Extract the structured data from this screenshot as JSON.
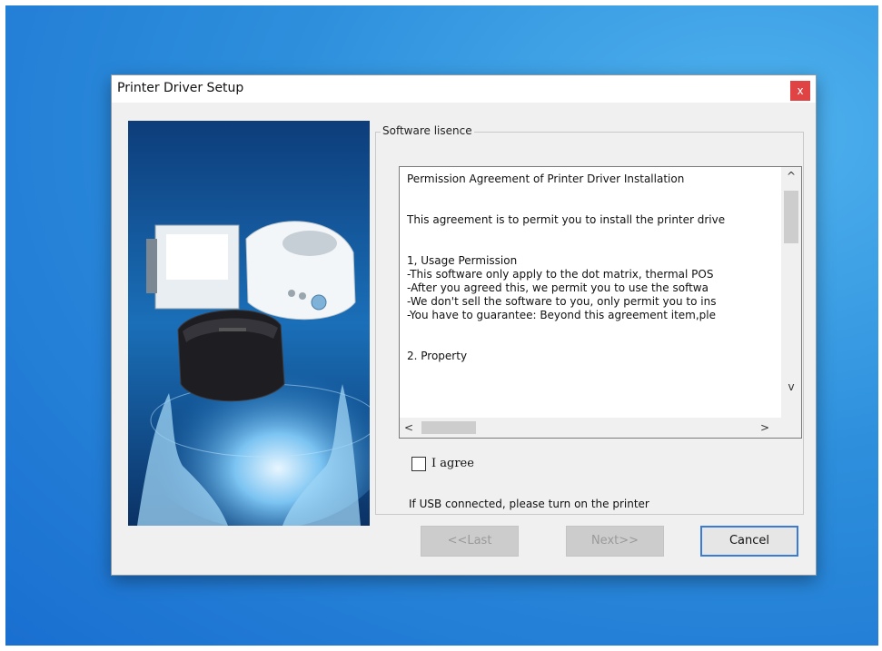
{
  "window": {
    "title": "Printer Driver Setup",
    "close_label": "x"
  },
  "license_group": {
    "label": "Software lisence",
    "text": "Permission Agreement of Printer Driver Installation\n\n\nThis agreement is to permit you to install the printer drive\n\n\n1, Usage Permission\n-This software only apply to the dot matrix, thermal POS\n-After you agreed this, we permit you to use the softwa\n-We don't sell the software to you, only permit you to ins\n-You have to guarantee: Beyond this agreement item,ple\n\n\n2. Property",
    "scroll_up_icon": "chevron-up",
    "scroll_down_icon": "chevron-down",
    "scroll_left_icon": "chevron-left",
    "scroll_right_icon": "chevron-right",
    "scroll_up_glyph": "^",
    "scroll_down_glyph": "v",
    "scroll_left_glyph": "<",
    "scroll_right_glyph": ">"
  },
  "agree": {
    "label": "I agree",
    "checked": false
  },
  "usb_note": "If USB connected, please turn on the printer",
  "buttons": {
    "last": "<<Last",
    "next": "Next>>",
    "cancel": "Cancel"
  },
  "colors": {
    "desktop": "#1a6fd0",
    "close": "#e04343",
    "accent": "#3a7bd5"
  }
}
